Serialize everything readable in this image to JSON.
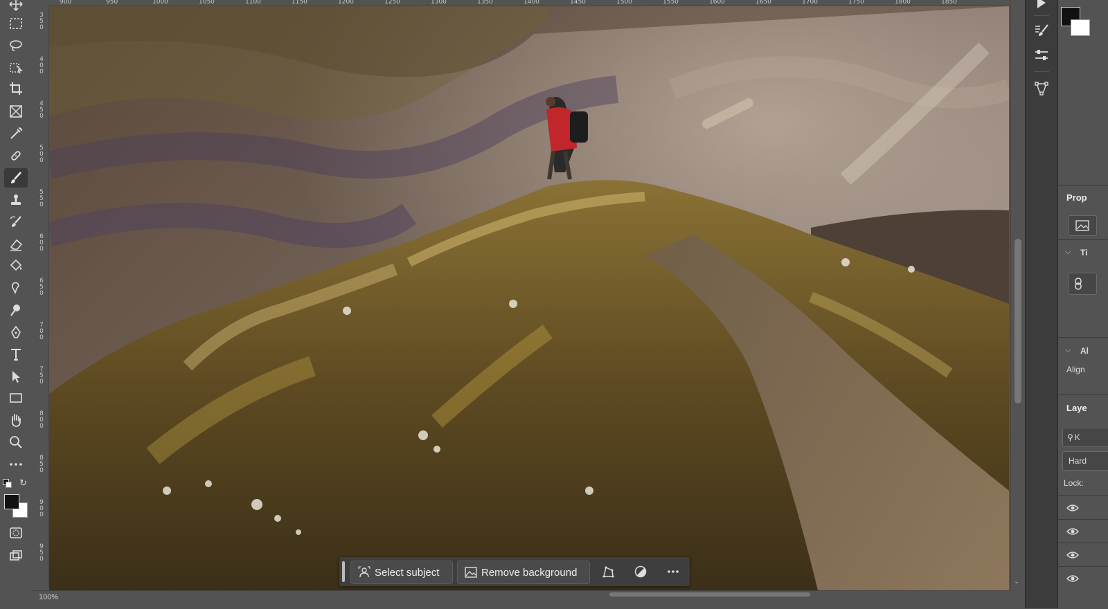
{
  "toolbar": {
    "tools": [
      "move-tool",
      "rectangular-marquee-tool",
      "lasso-tool",
      "object-selection-tool",
      "crop-tool",
      "frame-tool",
      "eyedropper-tool",
      "spot-healing-brush-tool",
      "brush-tool",
      "clone-stamp-tool",
      "history-brush-tool",
      "eraser-tool",
      "paint-bucket-tool",
      "smudge-tool",
      "dodge-tool",
      "pen-tool",
      "type-tool",
      "path-selection-tool",
      "rectangle-tool",
      "hand-tool",
      "zoom-tool",
      "edit-toolbar"
    ],
    "active_tool": "brush-tool",
    "foreground_color": "#111111",
    "background_color": "#ffffff"
  },
  "rulers": {
    "left_labels": [
      "350",
      "400",
      "450",
      "500",
      "550",
      "600",
      "650",
      "700",
      "750",
      "800",
      "850",
      "900",
      "950"
    ],
    "top_labels": [
      "900",
      "950",
      "1000",
      "1050",
      "1100",
      "1150",
      "1200",
      "1250",
      "1300",
      "1350",
      "1400",
      "1450",
      "1500",
      "1550",
      "1600",
      "1650",
      "1700",
      "1750",
      "1800",
      "1850"
    ]
  },
  "taskbar": {
    "select_subject": "Select subject",
    "remove_background": "Remove background"
  },
  "right_panel": {
    "properties_title": "Prop",
    "section_t": "Ti",
    "section_align": "Al",
    "align_label": "Align",
    "layers_title": "Laye",
    "search_placeholder": "K",
    "blend_mode": "Hard",
    "lock_label": "Lock:"
  },
  "status": {
    "zoom": "100%"
  }
}
